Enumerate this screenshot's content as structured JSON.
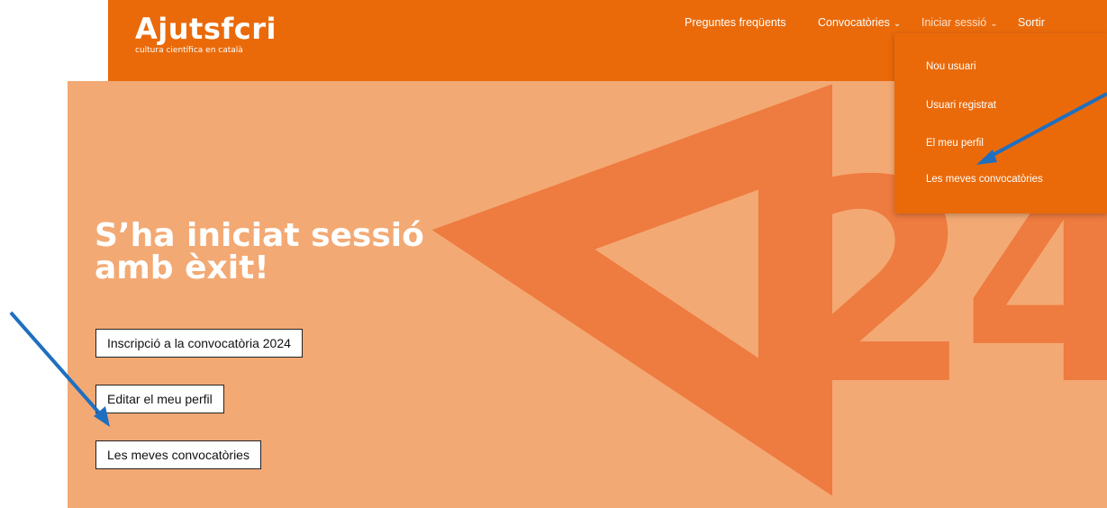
{
  "header": {
    "logo_text": "Ajutsfcri",
    "logo_tagline": "cultura científica en català",
    "nav": [
      {
        "label": "Preguntes freqüents",
        "has_dropdown": false
      },
      {
        "label": "Convocatòries",
        "has_dropdown": true
      },
      {
        "label": "Iniciar sessió",
        "has_dropdown": true
      },
      {
        "label": "Sortir",
        "has_dropdown": false
      }
    ],
    "chevron_glyph": "⌄"
  },
  "dropdown": {
    "items": [
      "Nou usuari",
      "Usuari registrat",
      "El meu perfil",
      "Les meves convocatòries"
    ]
  },
  "hero": {
    "title": "S’ha iniciat sessió amb èxit!",
    "buttons": [
      "Inscripció a la convocatòria 2024",
      "Editar el meu perfil",
      "Les meves convocatòries"
    ],
    "graphic_text": "24"
  },
  "colors": {
    "brand_orange": "#EA6A0A",
    "hero_bg": "#F3A974",
    "hero_graphic": "#EE7B3F",
    "annotation_arrow": "#1F6FC0"
  },
  "icons": [
    "chevron-down-icon",
    "annotation-arrow"
  ]
}
